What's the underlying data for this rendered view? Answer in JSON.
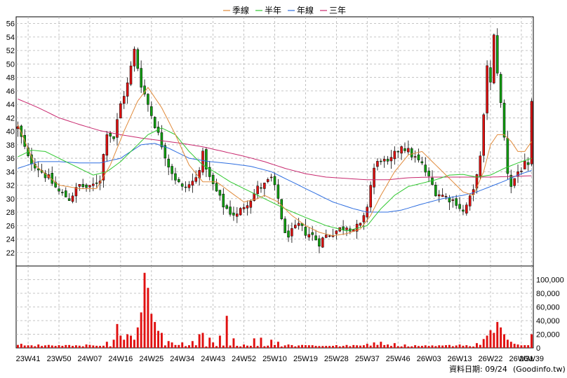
{
  "legend": [
    {
      "label": "季線",
      "color": "#e08a3a"
    },
    {
      "label": "半年",
      "color": "#2ec82e"
    },
    {
      "label": "年線",
      "color": "#2e6ee0"
    },
    {
      "label": "三年",
      "color": "#c8286e"
    }
  ],
  "footer": {
    "date_label": "資料日期: 09/24",
    "source": "(Goodinfo.tw)"
  },
  "colors": {
    "up": "#e01010",
    "down": "#10a010",
    "grid": "#b4b4b4",
    "volume": "#e01010"
  },
  "chart_data": [
    {
      "type": "candlestick",
      "title": "",
      "ylim": [
        20,
        57
      ],
      "yticks": [
        22,
        24,
        26,
        28,
        30,
        32,
        34,
        36,
        38,
        40,
        42,
        44,
        46,
        48,
        50,
        52,
        54,
        56
      ],
      "x_count": 151,
      "x_tick_labels": [
        {
          "i": 3,
          "label": "23W41"
        },
        {
          "i": 12,
          "label": "23W50"
        },
        {
          "i": 21,
          "label": "24W07"
        },
        {
          "i": 30,
          "label": "24W16"
        },
        {
          "i": 39,
          "label": "24W25"
        },
        {
          "i": 48,
          "label": "24W34"
        },
        {
          "i": 57,
          "label": "24W43"
        },
        {
          "i": 66,
          "label": "24W52"
        },
        {
          "i": 75,
          "label": "25W10"
        },
        {
          "i": 84,
          "label": "25W19"
        },
        {
          "i": 93,
          "label": "25W28"
        },
        {
          "i": 102,
          "label": "25W37"
        },
        {
          "i": 111,
          "label": "25W46"
        },
        {
          "i": 120,
          "label": "26W03"
        },
        {
          "i": 129,
          "label": "26W13"
        },
        {
          "i": 138,
          "label": "26W22"
        },
        {
          "i": 147,
          "label": "26W31"
        },
        {
          "i": 150,
          "label": "26W39"
        }
      ],
      "anchors": [
        [
          0,
          40.5
        ],
        [
          3,
          36
        ],
        [
          6,
          34.5
        ],
        [
          9,
          33
        ],
        [
          12,
          31
        ],
        [
          15,
          30
        ],
        [
          18,
          32
        ],
        [
          21,
          31.5
        ],
        [
          24,
          33
        ],
        [
          26,
          40
        ],
        [
          28,
          39
        ],
        [
          30,
          44
        ],
        [
          32,
          47
        ],
        [
          34,
          52
        ],
        [
          36,
          47
        ],
        [
          38,
          44
        ],
        [
          40,
          41
        ],
        [
          42,
          38
        ],
        [
          44,
          35
        ],
        [
          46,
          33
        ],
        [
          48,
          31.5
        ],
        [
          50,
          32
        ],
        [
          52,
          33
        ],
        [
          54,
          36.5
        ],
        [
          56,
          33
        ],
        [
          58,
          31
        ],
        [
          60,
          29
        ],
        [
          62,
          28
        ],
        [
          64,
          27.5
        ],
        [
          66,
          29
        ],
        [
          68,
          30
        ],
        [
          70,
          31.5
        ],
        [
          72,
          32
        ],
        [
          74,
          33
        ],
        [
          76,
          30
        ],
        [
          78,
          24.5
        ],
        [
          80,
          25
        ],
        [
          82,
          26
        ],
        [
          84,
          25
        ],
        [
          86,
          24.5
        ],
        [
          88,
          23.5
        ],
        [
          90,
          24.5
        ],
        [
          92,
          25
        ],
        [
          94,
          25.5
        ],
        [
          96,
          26
        ],
        [
          98,
          25.5
        ],
        [
          100,
          26
        ],
        [
          101,
          27
        ],
        [
          102,
          29
        ],
        [
          103,
          32
        ],
        [
          104,
          34.5
        ],
        [
          106,
          36
        ],
        [
          108,
          35
        ],
        [
          110,
          36.5
        ],
        [
          112,
          38
        ],
        [
          114,
          37
        ],
        [
          116,
          36
        ],
        [
          118,
          35
        ],
        [
          120,
          33
        ],
        [
          122,
          31
        ],
        [
          124,
          30.5
        ],
        [
          126,
          30
        ],
        [
          128,
          29.5
        ],
        [
          130,
          28
        ],
        [
          132,
          30
        ],
        [
          133,
          31
        ],
        [
          134,
          34
        ],
        [
          135,
          36
        ],
        [
          136,
          42
        ],
        [
          137,
          50
        ],
        [
          138,
          47
        ],
        [
          139,
          54
        ],
        [
          140,
          49
        ],
        [
          141,
          44
        ],
        [
          142,
          39
        ],
        [
          143,
          34
        ],
        [
          144,
          32
        ],
        [
          145,
          33
        ],
        [
          146,
          34
        ],
        [
          147,
          34.5
        ],
        [
          148,
          35
        ],
        [
          149,
          34.5
        ],
        [
          150,
          44
        ]
      ],
      "ma_quarter_anchors": [
        [
          0,
          41
        ],
        [
          5,
          35
        ],
        [
          12,
          32
        ],
        [
          18,
          31.5
        ],
        [
          23,
          31.5
        ],
        [
          27,
          35
        ],
        [
          31,
          40
        ],
        [
          35,
          44.5
        ],
        [
          38,
          46.5
        ],
        [
          42,
          43.5
        ],
        [
          46,
          39.5
        ],
        [
          50,
          35
        ],
        [
          54,
          32.5
        ],
        [
          58,
          32.5
        ],
        [
          62,
          31
        ],
        [
          66,
          29.5
        ],
        [
          70,
          30
        ],
        [
          72,
          30.5
        ],
        [
          74,
          30
        ],
        [
          76,
          29.5
        ],
        [
          80,
          27.5
        ],
        [
          84,
          26
        ],
        [
          88,
          25
        ],
        [
          92,
          24.5
        ],
        [
          96,
          24.8
        ],
        [
          100,
          25.5
        ],
        [
          103,
          27.5
        ],
        [
          106,
          30.5
        ],
        [
          110,
          34
        ],
        [
          114,
          36.5
        ],
        [
          118,
          37
        ],
        [
          122,
          35
        ],
        [
          126,
          33
        ],
        [
          130,
          31
        ],
        [
          133,
          30.5
        ],
        [
          136,
          34
        ],
        [
          138,
          38
        ],
        [
          140,
          39.5
        ],
        [
          142,
          39.5
        ],
        [
          144,
          38.5
        ],
        [
          146,
          37
        ],
        [
          148,
          37
        ],
        [
          150,
          38.5
        ]
      ],
      "ma_half_anchors": [
        [
          0,
          36.2
        ],
        [
          4,
          37.2
        ],
        [
          8,
          37
        ],
        [
          12,
          36
        ],
        [
          18,
          34.5
        ],
        [
          22,
          33.5
        ],
        [
          26,
          34
        ],
        [
          30,
          35.5
        ],
        [
          34,
          37.5
        ],
        [
          38,
          39.5
        ],
        [
          42,
          40.5
        ],
        [
          46,
          39.5
        ],
        [
          50,
          37
        ],
        [
          54,
          35
        ],
        [
          58,
          33.8
        ],
        [
          62,
          32.5
        ],
        [
          66,
          31.5
        ],
        [
          70,
          30.5
        ],
        [
          74,
          29.5
        ],
        [
          78,
          28.5
        ],
        [
          84,
          27.2
        ],
        [
          90,
          26
        ],
        [
          96,
          25.2
        ],
        [
          102,
          26
        ],
        [
          106,
          28.5
        ],
        [
          110,
          30.5
        ],
        [
          114,
          31.8
        ],
        [
          118,
          32.3
        ],
        [
          122,
          32.8
        ],
        [
          126,
          33.5
        ],
        [
          130,
          33.6
        ],
        [
          134,
          33.2
        ],
        [
          138,
          33.5
        ],
        [
          142,
          34.5
        ],
        [
          146,
          35.3
        ],
        [
          150,
          36
        ]
      ],
      "ma_year_anchors": [
        [
          0,
          34.5
        ],
        [
          6,
          35.5
        ],
        [
          12,
          35.5
        ],
        [
          18,
          35.3
        ],
        [
          24,
          35.3
        ],
        [
          30,
          36
        ],
        [
          36,
          38
        ],
        [
          40,
          38.2
        ],
        [
          44,
          37.5
        ],
        [
          50,
          36
        ],
        [
          56,
          35.5
        ],
        [
          62,
          35.2
        ],
        [
          68,
          34.8
        ],
        [
          74,
          34
        ],
        [
          80,
          32.5
        ],
        [
          86,
          31
        ],
        [
          92,
          29.5
        ],
        [
          98,
          28.5
        ],
        [
          102,
          28
        ],
        [
          108,
          28
        ],
        [
          112,
          28.3
        ],
        [
          118,
          29.2
        ],
        [
          124,
          30
        ],
        [
          130,
          30.5
        ],
        [
          134,
          31
        ],
        [
          138,
          31.8
        ],
        [
          142,
          32.6
        ],
        [
          146,
          33.5
        ],
        [
          150,
          34.2
        ]
      ],
      "ma_3y_anchors": [
        [
          0,
          44.8
        ],
        [
          6,
          43.5
        ],
        [
          12,
          42
        ],
        [
          18,
          41
        ],
        [
          24,
          40.1
        ],
        [
          30,
          39.5
        ],
        [
          36,
          39
        ],
        [
          42,
          38.6
        ],
        [
          48,
          38.2
        ],
        [
          54,
          37.7
        ],
        [
          60,
          37
        ],
        [
          66,
          36.3
        ],
        [
          72,
          35.5
        ],
        [
          78,
          34.5
        ],
        [
          84,
          33.7
        ],
        [
          90,
          33.2
        ],
        [
          96,
          33
        ],
        [
          102,
          32.8
        ],
        [
          108,
          32.8
        ],
        [
          114,
          33.1
        ],
        [
          120,
          33.2
        ],
        [
          126,
          33.2
        ],
        [
          132,
          33.2
        ],
        [
          138,
          33.2
        ],
        [
          144,
          33.3
        ],
        [
          150,
          33.4
        ]
      ]
    },
    {
      "type": "bar",
      "title": "",
      "ylim": [
        0,
        120000
      ],
      "yticks": [
        0,
        20000,
        40000,
        60000,
        80000,
        100000
      ],
      "ytick_labels": [
        "0",
        "20,000",
        "40,000",
        "60,000",
        "80,000",
        "100,000"
      ],
      "baseline": 2000,
      "spikes": [
        [
          1,
          6000
        ],
        [
          6,
          5000
        ],
        [
          12,
          4000
        ],
        [
          16,
          3000
        ],
        [
          20,
          5000
        ],
        [
          24,
          3000
        ],
        [
          26,
          9000
        ],
        [
          28,
          12000
        ],
        [
          29,
          35000
        ],
        [
          30,
          18000
        ],
        [
          31,
          12000
        ],
        [
          32,
          20000
        ],
        [
          33,
          18000
        ],
        [
          34,
          12000
        ],
        [
          35,
          30000
        ],
        [
          36,
          52000
        ],
        [
          37,
          110000
        ],
        [
          38,
          88000
        ],
        [
          39,
          50000
        ],
        [
          40,
          38000
        ],
        [
          41,
          25000
        ],
        [
          42,
          22000
        ],
        [
          44,
          10000
        ],
        [
          45,
          8000
        ],
        [
          48,
          8000
        ],
        [
          51,
          10000
        ],
        [
          53,
          20000
        ],
        [
          54,
          22000
        ],
        [
          56,
          15000
        ],
        [
          57,
          8000
        ],
        [
          59,
          18000
        ],
        [
          61,
          47000
        ],
        [
          63,
          14000
        ],
        [
          66,
          5000
        ],
        [
          69,
          14000
        ],
        [
          71,
          15000
        ],
        [
          74,
          12000
        ],
        [
          76,
          9000
        ],
        [
          79,
          5000
        ],
        [
          84,
          4000
        ],
        [
          87,
          3000
        ],
        [
          95,
          3000
        ],
        [
          102,
          6000
        ],
        [
          104,
          8000
        ],
        [
          106,
          9000
        ],
        [
          108,
          5000
        ],
        [
          110,
          7000
        ],
        [
          113,
          5000
        ],
        [
          118,
          3000
        ],
        [
          125,
          4000
        ],
        [
          129,
          5000
        ],
        [
          131,
          4000
        ],
        [
          134,
          7000
        ],
        [
          136,
          13000
        ],
        [
          137,
          18000
        ],
        [
          138,
          26000
        ],
        [
          139,
          22000
        ],
        [
          140,
          38000
        ],
        [
          141,
          30000
        ],
        [
          142,
          20000
        ],
        [
          143,
          12000
        ],
        [
          144,
          9000
        ],
        [
          145,
          6000
        ],
        [
          146,
          5000
        ],
        [
          148,
          4000
        ],
        [
          150,
          20000
        ]
      ]
    }
  ]
}
